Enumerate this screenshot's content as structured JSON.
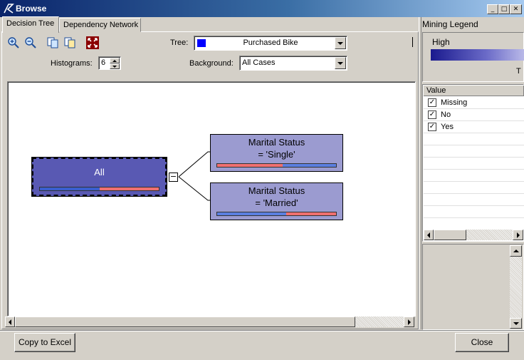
{
  "window": {
    "title": "Browse"
  },
  "title_buttons": {
    "minimize": "_",
    "maximize": "□",
    "close": "✕"
  },
  "tabs": [
    {
      "label": "Decision Tree",
      "active": true
    },
    {
      "label": "Dependency Network",
      "active": false
    }
  ],
  "toolbar": {
    "tree_label": "Tree:",
    "tree_value": "Purchased Bike",
    "tree_color": "#0000ff",
    "histograms_label": "Histograms:",
    "histograms_value": "6",
    "background_label": "Background:",
    "background_value": "All Cases"
  },
  "tree": {
    "root": {
      "label": "All",
      "bar": [
        {
          "color": "#3a5fcd",
          "fraction": 0.5
        },
        {
          "color": "#f07070",
          "fraction": 0.5
        }
      ]
    },
    "expand_symbol": "−",
    "children": [
      {
        "line1": "Marital Status",
        "line2": "= 'Single'",
        "bar": [
          {
            "color": "#f07070",
            "fraction": 0.55
          },
          {
            "color": "#5b7fe0",
            "fraction": 0.45
          }
        ]
      },
      {
        "line1": "Marital Status",
        "line2": "= 'Married'",
        "bar": [
          {
            "color": "#5b7fe0",
            "fraction": 0.58
          },
          {
            "color": "#f07070",
            "fraction": 0.42
          }
        ]
      }
    ]
  },
  "legend": {
    "title": "Mining Legend",
    "high_label": "High",
    "truncated_label": "T",
    "column_header": "Value",
    "items": [
      {
        "label": "Missing",
        "checked": true
      },
      {
        "label": "No",
        "checked": true
      },
      {
        "label": "Yes",
        "checked": true
      }
    ]
  },
  "buttons": {
    "copy": "Copy to Excel",
    "close": "Close"
  },
  "colors": {
    "title_bar_start": "#0a246a",
    "title_bar_end": "#a6caf0",
    "root_node": "#5959b3",
    "child_node": "#9b9bd0"
  }
}
